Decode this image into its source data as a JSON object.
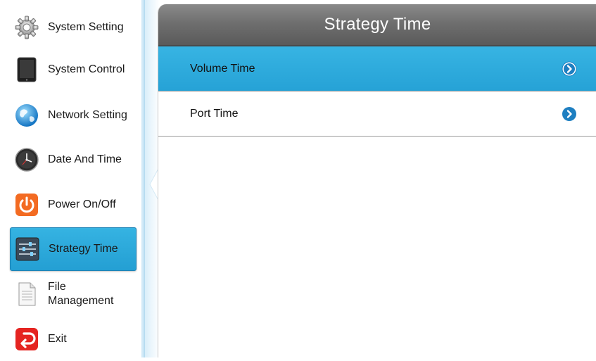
{
  "sidebar": {
    "items": [
      {
        "label": "System Setting",
        "icon": "gear-icon"
      },
      {
        "label": "System Control",
        "icon": "tablet-icon"
      },
      {
        "label": "Network Setting",
        "icon": "globe-icon"
      },
      {
        "label": "Date And Time",
        "icon": "clock-icon"
      },
      {
        "label": "Power On/Off",
        "icon": "power-icon"
      },
      {
        "label": "Strategy Time",
        "icon": "sliders-icon",
        "active": true
      },
      {
        "label": "File\nManagement",
        "label_line1": "File",
        "label_line2": "Management",
        "icon": "document-icon"
      },
      {
        "label": "Exit",
        "icon": "exit-icon"
      }
    ]
  },
  "main": {
    "title": "Strategy Time",
    "rows": [
      {
        "label": "Volume Time",
        "selected": true,
        "icon": "chevron-right-circle-icon"
      },
      {
        "label": "Port Time",
        "selected": false,
        "icon": "chevron-right-circle-icon"
      }
    ]
  },
  "colors": {
    "accent": "#2aa8dc",
    "header": "#6f6f6f",
    "arrow": "#1e7fc1"
  }
}
